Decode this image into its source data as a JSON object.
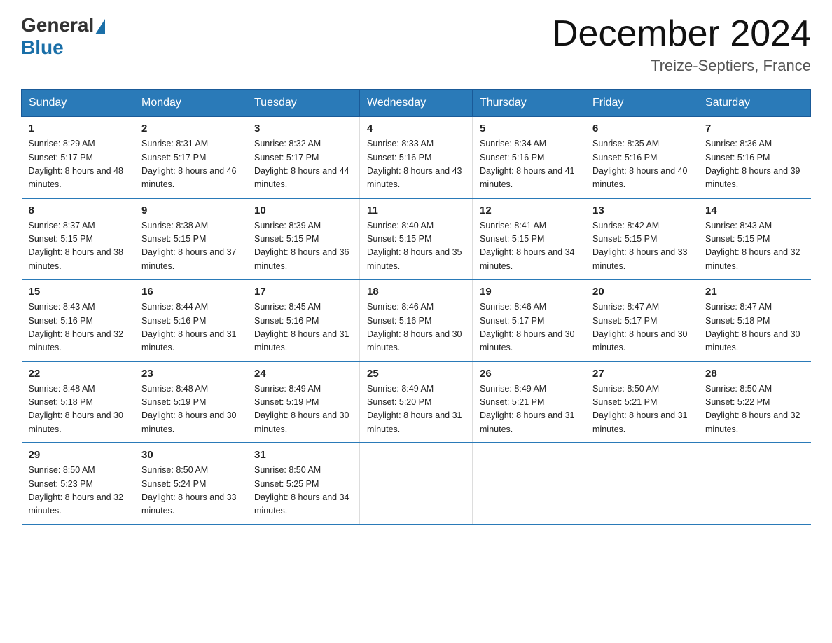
{
  "header": {
    "logo_general": "General",
    "logo_blue": "Blue",
    "month_title": "December 2024",
    "location": "Treize-Septiers, France"
  },
  "days_of_week": [
    "Sunday",
    "Monday",
    "Tuesday",
    "Wednesday",
    "Thursday",
    "Friday",
    "Saturday"
  ],
  "weeks": [
    [
      {
        "day": "1",
        "sunrise": "Sunrise: 8:29 AM",
        "sunset": "Sunset: 5:17 PM",
        "daylight": "Daylight: 8 hours and 48 minutes."
      },
      {
        "day": "2",
        "sunrise": "Sunrise: 8:31 AM",
        "sunset": "Sunset: 5:17 PM",
        "daylight": "Daylight: 8 hours and 46 minutes."
      },
      {
        "day": "3",
        "sunrise": "Sunrise: 8:32 AM",
        "sunset": "Sunset: 5:17 PM",
        "daylight": "Daylight: 8 hours and 44 minutes."
      },
      {
        "day": "4",
        "sunrise": "Sunrise: 8:33 AM",
        "sunset": "Sunset: 5:16 PM",
        "daylight": "Daylight: 8 hours and 43 minutes."
      },
      {
        "day": "5",
        "sunrise": "Sunrise: 8:34 AM",
        "sunset": "Sunset: 5:16 PM",
        "daylight": "Daylight: 8 hours and 41 minutes."
      },
      {
        "day": "6",
        "sunrise": "Sunrise: 8:35 AM",
        "sunset": "Sunset: 5:16 PM",
        "daylight": "Daylight: 8 hours and 40 minutes."
      },
      {
        "day": "7",
        "sunrise": "Sunrise: 8:36 AM",
        "sunset": "Sunset: 5:16 PM",
        "daylight": "Daylight: 8 hours and 39 minutes."
      }
    ],
    [
      {
        "day": "8",
        "sunrise": "Sunrise: 8:37 AM",
        "sunset": "Sunset: 5:15 PM",
        "daylight": "Daylight: 8 hours and 38 minutes."
      },
      {
        "day": "9",
        "sunrise": "Sunrise: 8:38 AM",
        "sunset": "Sunset: 5:15 PM",
        "daylight": "Daylight: 8 hours and 37 minutes."
      },
      {
        "day": "10",
        "sunrise": "Sunrise: 8:39 AM",
        "sunset": "Sunset: 5:15 PM",
        "daylight": "Daylight: 8 hours and 36 minutes."
      },
      {
        "day": "11",
        "sunrise": "Sunrise: 8:40 AM",
        "sunset": "Sunset: 5:15 PM",
        "daylight": "Daylight: 8 hours and 35 minutes."
      },
      {
        "day": "12",
        "sunrise": "Sunrise: 8:41 AM",
        "sunset": "Sunset: 5:15 PM",
        "daylight": "Daylight: 8 hours and 34 minutes."
      },
      {
        "day": "13",
        "sunrise": "Sunrise: 8:42 AM",
        "sunset": "Sunset: 5:15 PM",
        "daylight": "Daylight: 8 hours and 33 minutes."
      },
      {
        "day": "14",
        "sunrise": "Sunrise: 8:43 AM",
        "sunset": "Sunset: 5:15 PM",
        "daylight": "Daylight: 8 hours and 32 minutes."
      }
    ],
    [
      {
        "day": "15",
        "sunrise": "Sunrise: 8:43 AM",
        "sunset": "Sunset: 5:16 PM",
        "daylight": "Daylight: 8 hours and 32 minutes."
      },
      {
        "day": "16",
        "sunrise": "Sunrise: 8:44 AM",
        "sunset": "Sunset: 5:16 PM",
        "daylight": "Daylight: 8 hours and 31 minutes."
      },
      {
        "day": "17",
        "sunrise": "Sunrise: 8:45 AM",
        "sunset": "Sunset: 5:16 PM",
        "daylight": "Daylight: 8 hours and 31 minutes."
      },
      {
        "day": "18",
        "sunrise": "Sunrise: 8:46 AM",
        "sunset": "Sunset: 5:16 PM",
        "daylight": "Daylight: 8 hours and 30 minutes."
      },
      {
        "day": "19",
        "sunrise": "Sunrise: 8:46 AM",
        "sunset": "Sunset: 5:17 PM",
        "daylight": "Daylight: 8 hours and 30 minutes."
      },
      {
        "day": "20",
        "sunrise": "Sunrise: 8:47 AM",
        "sunset": "Sunset: 5:17 PM",
        "daylight": "Daylight: 8 hours and 30 minutes."
      },
      {
        "day": "21",
        "sunrise": "Sunrise: 8:47 AM",
        "sunset": "Sunset: 5:18 PM",
        "daylight": "Daylight: 8 hours and 30 minutes."
      }
    ],
    [
      {
        "day": "22",
        "sunrise": "Sunrise: 8:48 AM",
        "sunset": "Sunset: 5:18 PM",
        "daylight": "Daylight: 8 hours and 30 minutes."
      },
      {
        "day": "23",
        "sunrise": "Sunrise: 8:48 AM",
        "sunset": "Sunset: 5:19 PM",
        "daylight": "Daylight: 8 hours and 30 minutes."
      },
      {
        "day": "24",
        "sunrise": "Sunrise: 8:49 AM",
        "sunset": "Sunset: 5:19 PM",
        "daylight": "Daylight: 8 hours and 30 minutes."
      },
      {
        "day": "25",
        "sunrise": "Sunrise: 8:49 AM",
        "sunset": "Sunset: 5:20 PM",
        "daylight": "Daylight: 8 hours and 31 minutes."
      },
      {
        "day": "26",
        "sunrise": "Sunrise: 8:49 AM",
        "sunset": "Sunset: 5:21 PM",
        "daylight": "Daylight: 8 hours and 31 minutes."
      },
      {
        "day": "27",
        "sunrise": "Sunrise: 8:50 AM",
        "sunset": "Sunset: 5:21 PM",
        "daylight": "Daylight: 8 hours and 31 minutes."
      },
      {
        "day": "28",
        "sunrise": "Sunrise: 8:50 AM",
        "sunset": "Sunset: 5:22 PM",
        "daylight": "Daylight: 8 hours and 32 minutes."
      }
    ],
    [
      {
        "day": "29",
        "sunrise": "Sunrise: 8:50 AM",
        "sunset": "Sunset: 5:23 PM",
        "daylight": "Daylight: 8 hours and 32 minutes."
      },
      {
        "day": "30",
        "sunrise": "Sunrise: 8:50 AM",
        "sunset": "Sunset: 5:24 PM",
        "daylight": "Daylight: 8 hours and 33 minutes."
      },
      {
        "day": "31",
        "sunrise": "Sunrise: 8:50 AM",
        "sunset": "Sunset: 5:25 PM",
        "daylight": "Daylight: 8 hours and 34 minutes."
      },
      null,
      null,
      null,
      null
    ]
  ]
}
